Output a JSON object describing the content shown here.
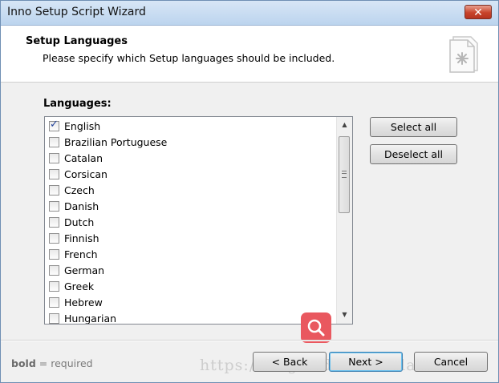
{
  "window": {
    "title": "Inno Setup Script Wizard",
    "close_label": "✕"
  },
  "header": {
    "title": "Setup Languages",
    "subtitle": "Please specify which Setup languages should be included.",
    "icon": "setup-wizard-icon"
  },
  "languages": {
    "label": "Languages:",
    "items": [
      {
        "label": "English",
        "checked": true
      },
      {
        "label": "Brazilian Portuguese",
        "checked": false
      },
      {
        "label": "Catalan",
        "checked": false
      },
      {
        "label": "Corsican",
        "checked": false
      },
      {
        "label": "Czech",
        "checked": false
      },
      {
        "label": "Danish",
        "checked": false
      },
      {
        "label": "Dutch",
        "checked": false
      },
      {
        "label": "Finnish",
        "checked": false
      },
      {
        "label": "French",
        "checked": false
      },
      {
        "label": "German",
        "checked": false
      },
      {
        "label": "Greek",
        "checked": false
      },
      {
        "label": "Hebrew",
        "checked": false
      },
      {
        "label": "Hungarian",
        "checked": false
      }
    ]
  },
  "buttons": {
    "select_all": "Select all",
    "deselect_all": "Deselect all",
    "back": "< Back",
    "next": "Next >",
    "cancel": "Cancel"
  },
  "footer": {
    "bold_word": "bold",
    "note": " = required"
  },
  "watermark": "https://blog.csdn.net/cclarse",
  "colors": {
    "title_bar": "#c4daf2",
    "close_button": "#c8442b",
    "zoom_badge": "#e9585f"
  }
}
